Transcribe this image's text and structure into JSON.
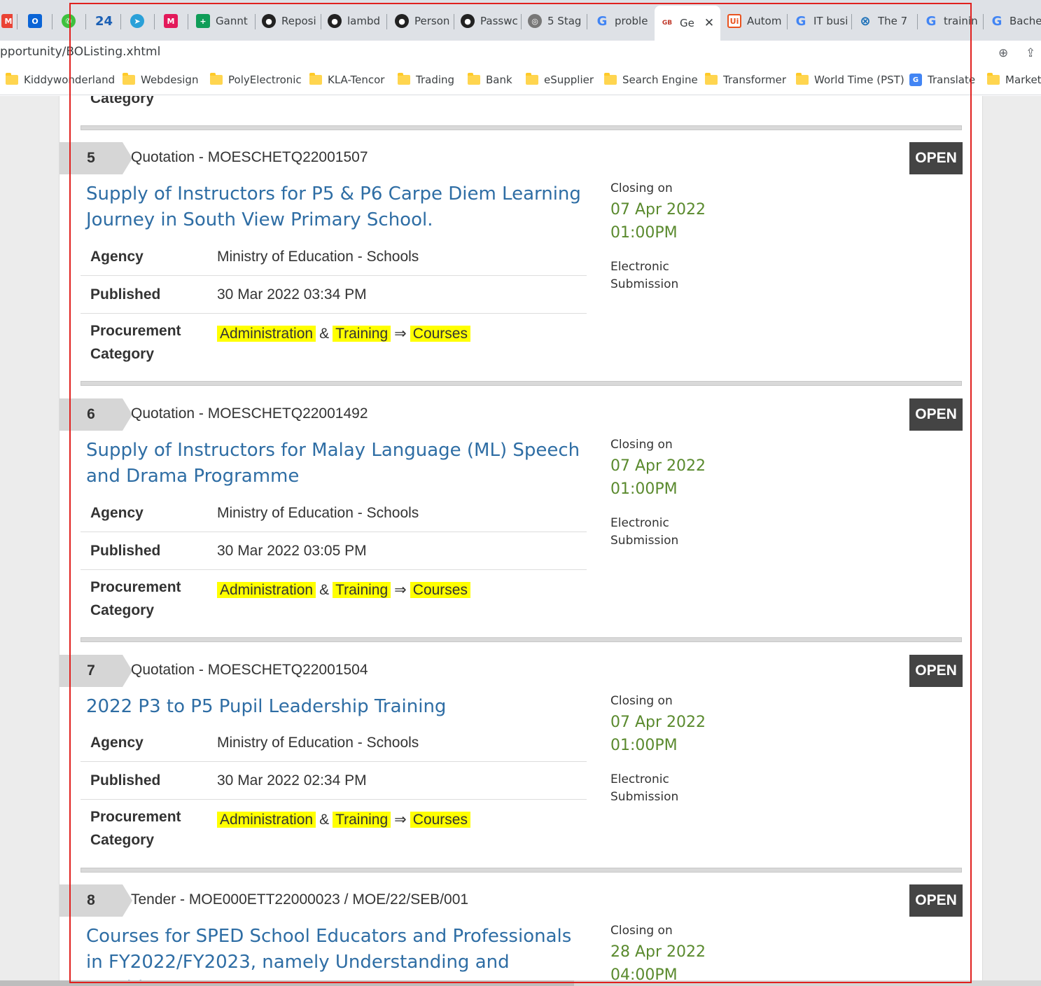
{
  "browser": {
    "tabs": [
      {
        "label": "",
        "icon": "gmail-icon"
      },
      {
        "label": "",
        "icon": "outlook-icon"
      },
      {
        "label": "",
        "icon": "whatsapp-icon"
      },
      {
        "label": "24",
        "icon": ""
      },
      {
        "label": "",
        "icon": "telegram-icon"
      },
      {
        "label": "",
        "icon": "app-m-icon"
      },
      {
        "label": "Gannt",
        "icon": "sheets-icon"
      },
      {
        "label": "Reposi",
        "icon": "github-icon"
      },
      {
        "label": "lambd",
        "icon": "github-icon"
      },
      {
        "label": "Person",
        "icon": "github-icon"
      },
      {
        "label": "Passwc",
        "icon": "github-icon"
      },
      {
        "label": "5 Stag",
        "icon": "globe-icon"
      },
      {
        "label": "proble",
        "icon": "google-icon"
      },
      {
        "label": "Ge",
        "icon": "gebiz-icon"
      },
      {
        "label": "Autom",
        "icon": "uipath-icon"
      },
      {
        "label": "IT busi",
        "icon": "google-icon"
      },
      {
        "label": "The 7",
        "icon": "circle-x-icon"
      },
      {
        "label": "trainin",
        "icon": "google-icon"
      },
      {
        "label": "Bachel",
        "icon": "google-icon"
      }
    ],
    "url": "pportunity/BOListing.xhtml",
    "bookmarks": [
      "Kiddywonderland",
      "Webdesign",
      "PolyElectronic",
      "KLA-Tencor",
      "Trading",
      "Bank",
      "eSupplier",
      "Search Engine",
      "Transformer",
      "World Time (PST)",
      "Translate",
      "Marketi"
    ]
  },
  "page": {
    "top_category_label": "Category",
    "labels": {
      "agency": "Agency",
      "published": "Published",
      "procurement_1": "Procurement",
      "procurement_2": "Category",
      "closing_on": "Closing on",
      "submission": "Electronic Submission"
    },
    "items": [
      {
        "num": "5",
        "ref": "Quotation - MOESCHETQ22001507",
        "status": "OPEN",
        "title": "Supply of Instructors for P5 & P6 Carpe Diem Learning Journey in South View Primary School.",
        "agency": "Ministry of Education - Schools",
        "published": "30 Mar 2022 03:34 PM",
        "cat1": "Administration",
        "and": "&",
        "cat2": "Training",
        "arrow": "⇒",
        "cat3": "Courses",
        "closing_date": "07 Apr 2022",
        "closing_time": "01:00PM"
      },
      {
        "num": "6",
        "ref": "Quotation - MOESCHETQ22001492",
        "status": "OPEN",
        "title": "Supply of Instructors for Malay Language (ML) Speech and Drama Programme",
        "agency": "Ministry of Education - Schools",
        "published": "30 Mar 2022 03:05 PM",
        "cat1": "Administration",
        "and": "&",
        "cat2": "Training",
        "arrow": "⇒",
        "cat3": "Courses",
        "closing_date": "07 Apr 2022",
        "closing_time": "01:00PM"
      },
      {
        "num": "7",
        "ref": "Quotation - MOESCHETQ22001504",
        "status": "OPEN",
        "title": "2022 P3 to P5 Pupil Leadership Training",
        "agency": "Ministry of Education - Schools",
        "published": "30 Mar 2022 02:34 PM",
        "cat1": "Administration",
        "and": "&",
        "cat2": "Training",
        "arrow": "⇒",
        "cat3": "Courses",
        "closing_date": "07 Apr 2022",
        "closing_time": "01:00PM"
      },
      {
        "num": "8",
        "ref": "Tender - MOE000ETT22000023 / MOE/22/SEB/001",
        "status": "OPEN",
        "title": "Courses for SPED School Educators and Professionals in FY2022/FY2023, namely Understanding and Teaching",
        "closing_date": "28 Apr 2022",
        "closing_time": "04:00PM"
      }
    ]
  }
}
